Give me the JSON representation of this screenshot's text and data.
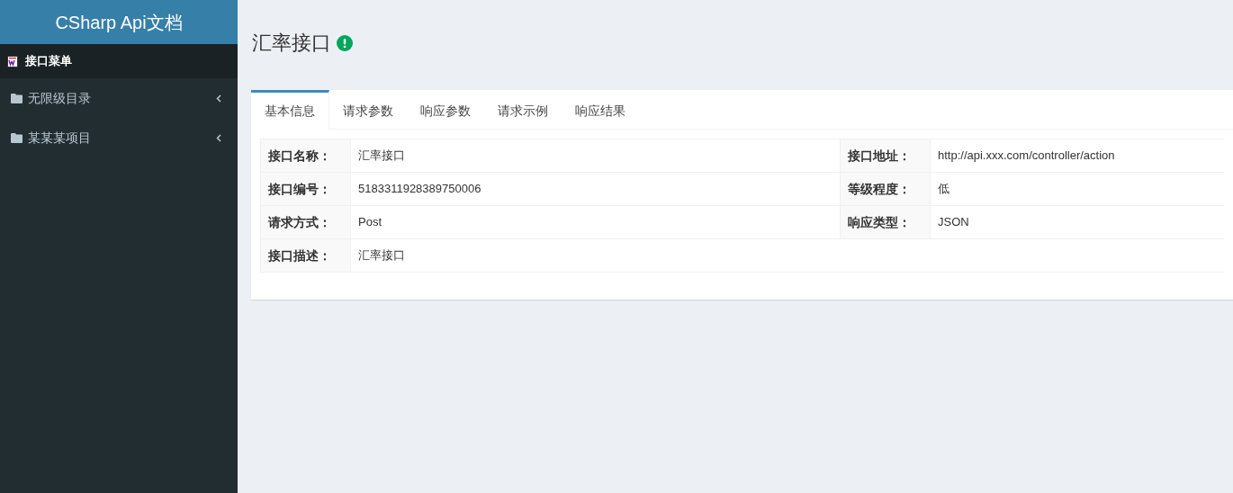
{
  "sidebar": {
    "brand": "CSharp Api文档",
    "menu_header": "接口菜单",
    "items": [
      {
        "label": "无限级目录",
        "expanded": false
      },
      {
        "label": "某某某项目",
        "expanded": false
      }
    ]
  },
  "page": {
    "title": "汇率接口"
  },
  "tabs": [
    {
      "label": "基本信息",
      "selected": true
    },
    {
      "label": "请求参数",
      "selected": false
    },
    {
      "label": "响应参数",
      "selected": false
    },
    {
      "label": "请求示例",
      "selected": false
    },
    {
      "label": "响应结果",
      "selected": false
    }
  ],
  "table": {
    "rows": [
      {
        "cells": [
          {
            "label": "接口名称：",
            "value": "汇率接口"
          },
          {
            "label": "接口地址：",
            "value": "http://api.xxx.com/controller/action"
          }
        ]
      },
      {
        "cells": [
          {
            "label": "接口编号：",
            "value": "5183311928389750006"
          },
          {
            "label": "等级程度：",
            "value": "低"
          }
        ]
      },
      {
        "cells": [
          {
            "label": "请求方式：",
            "value": "Post"
          },
          {
            "label": "响应类型：",
            "value": "JSON"
          }
        ]
      },
      {
        "cells": [
          {
            "label": "接口描述：",
            "value": "汇率接口"
          }
        ]
      }
    ]
  }
}
